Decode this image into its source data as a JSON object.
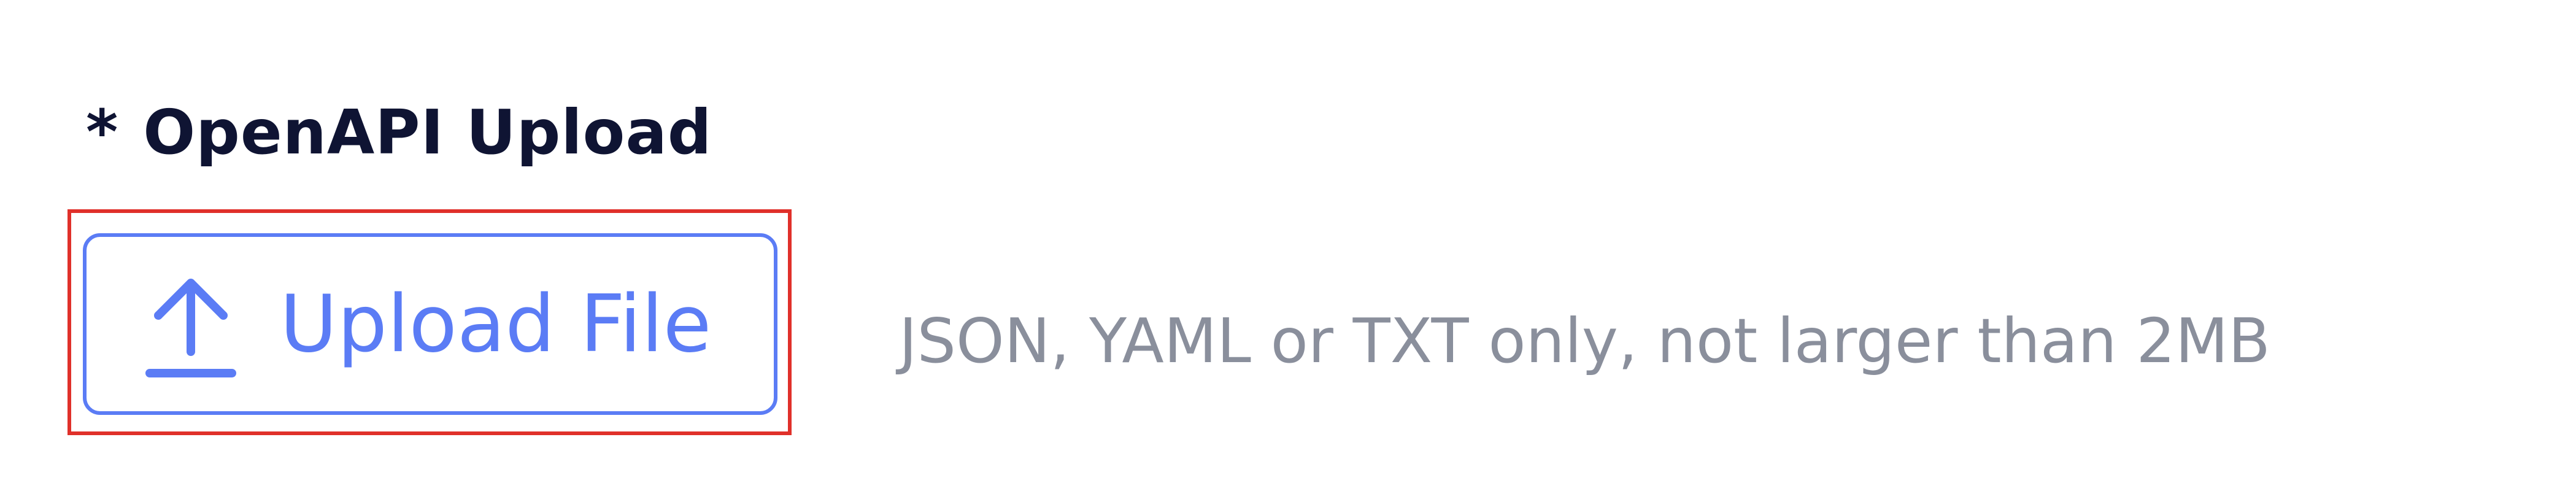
{
  "form": {
    "required_mark": "*",
    "label": "OpenAPI Upload",
    "upload_button": {
      "label": "Upload File",
      "icon": "upload-icon"
    },
    "hint": "JSON, YAML or TXT only, not larger than 2MB"
  },
  "colors": {
    "label": "#0f1433",
    "accent": "#5b7cf5",
    "hint": "#8a8f9c",
    "highlight": "#e0302a"
  }
}
